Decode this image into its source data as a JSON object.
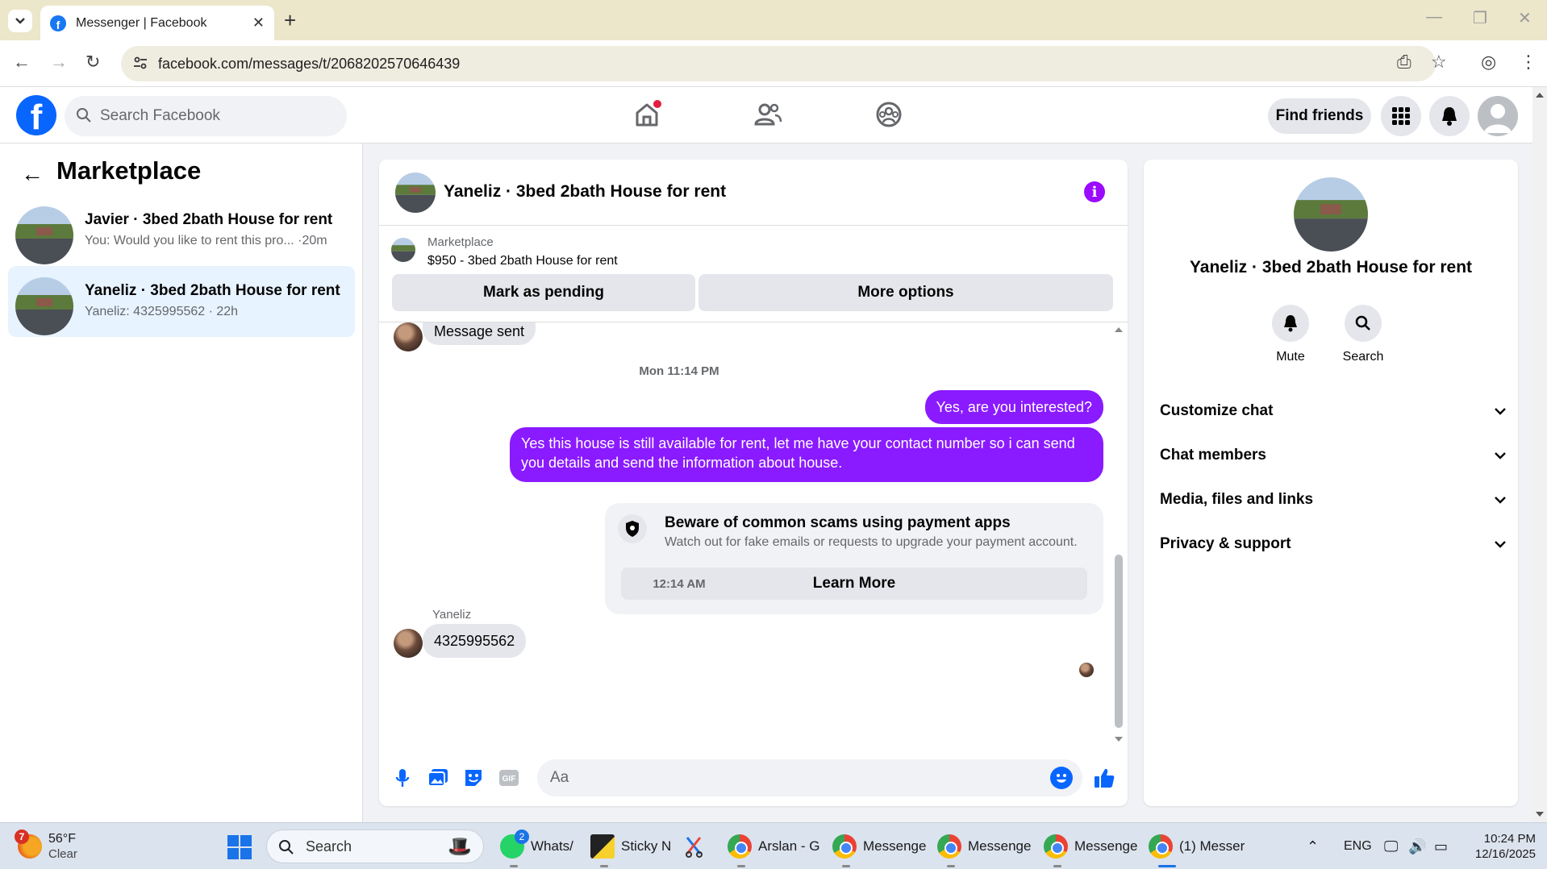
{
  "browser": {
    "tab_title": "Messenger | Facebook",
    "url": "facebook.com/messages/t/2068202570646439"
  },
  "fb_header": {
    "search_placeholder": "Search Facebook",
    "find_friends_label": "Find friends"
  },
  "left": {
    "title": "Marketplace",
    "conversations": [
      {
        "name": "Javier · 3bed 2bath House for rent",
        "preview": "You: Would you like to rent this pro... ·20m",
        "active": false
      },
      {
        "name": "Yaneliz · 3bed 2bath House for rent",
        "preview": "Yaneliz: 4325995562 · 22h",
        "active": true
      }
    ]
  },
  "thread": {
    "title": "Yaneliz · 3bed 2bath House for rent",
    "marketplace_label": "Marketplace",
    "listing": "$950 - 3bed 2bath House for rent",
    "mark_pending_label": "Mark as pending",
    "more_options_label": "More options",
    "messages": {
      "first_in": "Message sent",
      "stamp1": "Mon 11:14 PM",
      "out1": "Yes, are you interested?",
      "out2": "Yes this house is still available for rent, let me have your contact number so i can send you details and send the information about house.",
      "scam_title": "Beware of common scams using payment apps",
      "scam_desc": "Watch out for fake emails or requests to upgrade your payment account.",
      "learn_more": "Learn More",
      "stamp2": "12:14 AM",
      "sender": "Yaneliz",
      "last_in": "4325995562"
    },
    "composer_placeholder": "Aa"
  },
  "right_panel": {
    "name": "Yaneliz · 3bed 2bath House for rent",
    "mute_label": "Mute",
    "search_label": "Search",
    "sections": [
      "Customize chat",
      "Chat members",
      "Media, files and links",
      "Privacy & support"
    ]
  },
  "taskbar": {
    "weather_temp": "56°F",
    "weather_desc": "Clear",
    "weather_badge": "7",
    "search_label": "Search",
    "apps": [
      {
        "label": "Whats/",
        "badge": "2"
      },
      {
        "label": "Sticky N"
      },
      {
        "label": "Arslan - G"
      },
      {
        "label": "Messenge"
      },
      {
        "label": "Messenge"
      },
      {
        "label": "Messenge"
      },
      {
        "label": "(1) Messer"
      }
    ],
    "lang": "ENG",
    "time": "10:24 PM",
    "date": "12/16/2025"
  },
  "colors": {
    "accent": "#8a1aff",
    "fb_blue": "#0866ff"
  }
}
